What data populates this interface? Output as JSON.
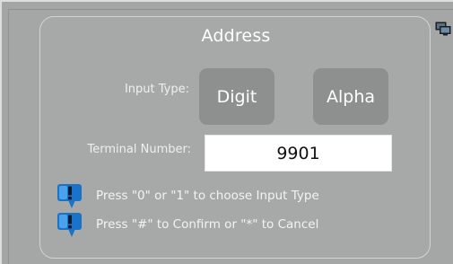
{
  "dialog": {
    "title": "Address",
    "input_type_label": "Input Type:",
    "terminal_label": "Terminal Number:",
    "buttons": {
      "digit": "Digit",
      "alpha": "Alpha"
    },
    "terminal_number": "9901",
    "hints": [
      {
        "icon": "speech-bubble-exclamation-icon",
        "text": "Press \"0\" or \"1\" to choose Input Type"
      },
      {
        "icon": "speech-bubble-exclamation-icon",
        "text": "Press \"#\" to Confirm or \"*\" to Cancel"
      }
    ]
  },
  "toolbar": {
    "icon": "monitor-windows-icon"
  },
  "colors": {
    "background": "#a4a7a5",
    "button_fill": "#8d908e",
    "text": "#ffffff",
    "icon_blue": "#1a73c9"
  }
}
